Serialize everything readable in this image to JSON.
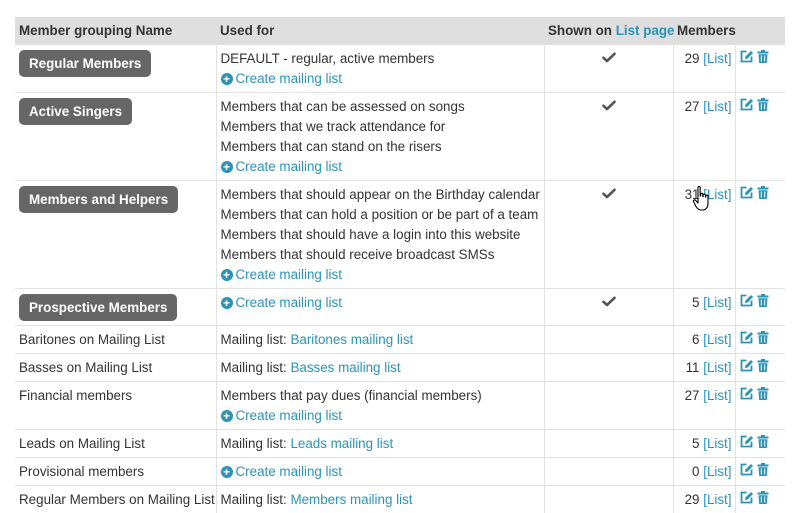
{
  "header": {
    "name": "Member grouping Name",
    "used_for": "Used for",
    "shown_prefix": "Shown on ",
    "shown_link": "List page",
    "members": "Members"
  },
  "create_label": "Create mailing list",
  "list_label": "[List]",
  "mailing_prefix": "Mailing list: ",
  "accent_color": "#2a93b8",
  "badge_color": "#666666",
  "icons": [
    "check-icon",
    "plus-circle-icon",
    "edit-icon",
    "trash-icon",
    "hand-cursor-icon"
  ],
  "rows": [
    {
      "name": "Regular Members",
      "badge": true,
      "lines": [
        "DEFAULT - regular, active members"
      ],
      "create": true,
      "shown": true,
      "count": "29"
    },
    {
      "name": "Active Singers",
      "badge": true,
      "lines": [
        "Members that can be assessed on songs",
        "Members that we track attendance for",
        "Members that can stand on the risers"
      ],
      "create": true,
      "shown": true,
      "count": "27"
    },
    {
      "name": "Members and Helpers",
      "badge": true,
      "lines": [
        "Members that should appear on the Birthday calendar",
        "Members that can hold a position or be part of a team",
        "Members that should have a login into this website",
        "Members that should receive broadcast SMSs"
      ],
      "create": true,
      "shown": true,
      "count": "31"
    },
    {
      "name": "Prospective Members",
      "badge": true,
      "lines": [],
      "create": true,
      "shown": true,
      "count": "5"
    },
    {
      "name": "Baritones on Mailing List",
      "badge": false,
      "mailing": "Baritones mailing list",
      "count": "6"
    },
    {
      "name": "Basses on Mailing List",
      "badge": false,
      "mailing": "Basses mailing list",
      "count": "11"
    },
    {
      "name": "Financial members",
      "badge": false,
      "lines": [
        "Members that pay dues (financial members)"
      ],
      "create": true,
      "count": "27"
    },
    {
      "name": "Leads on Mailing List",
      "badge": false,
      "mailing": "Leads mailing list",
      "count": "5"
    },
    {
      "name": "Provisional members",
      "badge": false,
      "lines": [],
      "create": true,
      "count": "0"
    },
    {
      "name": "Regular Members on Mailing List",
      "badge": false,
      "mailing": "Members mailing list",
      "count": "29"
    }
  ]
}
